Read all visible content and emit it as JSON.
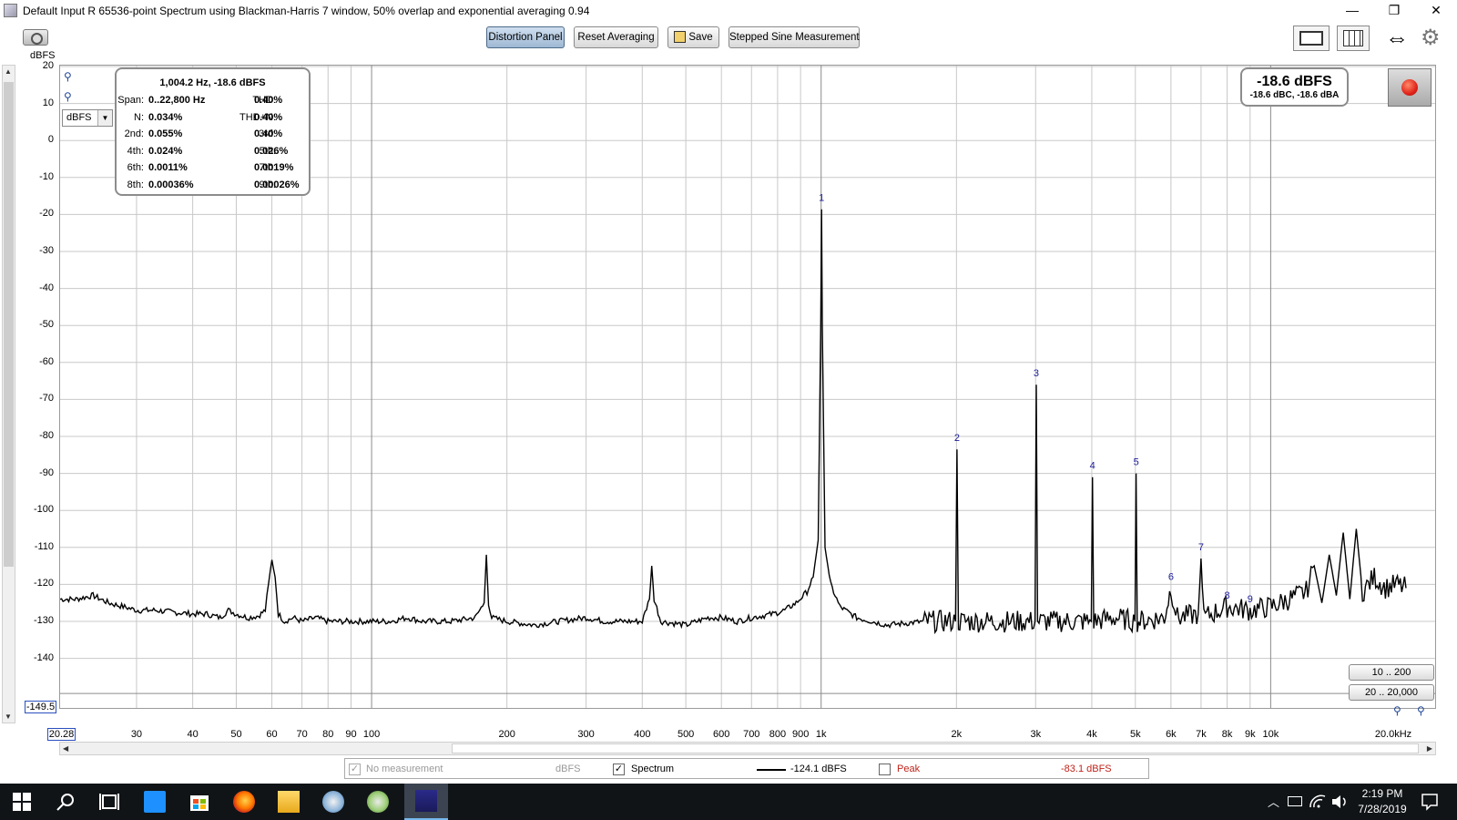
{
  "window": {
    "title": "Default Input R 65536-point Spectrum using Blackman-Harris 7 window, 50% overlap and exponential averaging 0.94",
    "controls": [
      "—",
      "❐",
      "✕"
    ]
  },
  "toolbar": {
    "distortion_panel": "Distortion Panel",
    "reset_averaging": "Reset Averaging",
    "save": "Save",
    "stepped_sine": "Stepped Sine Measurement"
  },
  "axis": {
    "y_unit": "dBFS",
    "y_ticks": [
      "20",
      "10",
      "0",
      "-10",
      "-20",
      "-30",
      "-40",
      "-50",
      "-60",
      "-70",
      "-80",
      "-90",
      "-100",
      "-110",
      "-120",
      "-130",
      "-140"
    ],
    "y_min_box": "-149.5",
    "x_min_box": "20.28",
    "x_ticks": [
      {
        "label": "30",
        "f": 30
      },
      {
        "label": "40",
        "f": 40
      },
      {
        "label": "50",
        "f": 50
      },
      {
        "label": "60",
        "f": 60
      },
      {
        "label": "70",
        "f": 70
      },
      {
        "label": "80",
        "f": 80
      },
      {
        "label": "90",
        "f": 90
      },
      {
        "label": "100",
        "f": 100
      },
      {
        "label": "200",
        "f": 200
      },
      {
        "label": "300",
        "f": 300
      },
      {
        "label": "400",
        "f": 400
      },
      {
        "label": "500",
        "f": 500
      },
      {
        "label": "600",
        "f": 600
      },
      {
        "label": "700",
        "f": 700
      },
      {
        "label": "800",
        "f": 800
      },
      {
        "label": "900",
        "f": 900
      },
      {
        "label": "1k",
        "f": 1000
      },
      {
        "label": "2k",
        "f": 2000
      },
      {
        "label": "3k",
        "f": 3000
      },
      {
        "label": "4k",
        "f": 4000
      },
      {
        "label": "5k",
        "f": 5000
      },
      {
        "label": "6k",
        "f": 6000
      },
      {
        "label": "7k",
        "f": 7000
      },
      {
        "label": "8k",
        "f": 8000
      },
      {
        "label": "9k",
        "f": 9000
      },
      {
        "label": "10k",
        "f": 10000
      },
      {
        "label": "20.0kHz",
        "f": 20000
      }
    ]
  },
  "unit_select": "dBFS",
  "distortion": {
    "header": "1,004.2 Hz, -18.6 dBFS",
    "rows": [
      {
        "l1": "Span:",
        "v1": "0..22,800 Hz",
        "l2": "THD:",
        "v2": "0.40%"
      },
      {
        "l1": "N:",
        "v1": "0.034%",
        "l2": "THD+N:",
        "v2": "0.40%"
      },
      {
        "l1": "2nd:",
        "v1": "0.055%",
        "l2": "3rd:",
        "v2": "0.40%"
      },
      {
        "l1": "4th:",
        "v1": "0.024%",
        "l2": "5th:",
        "v2": "0.026%"
      },
      {
        "l1": "6th:",
        "v1": "0.0011%",
        "l2": "7th:",
        "v2": "0.0019%"
      },
      {
        "l1": "8th:",
        "v1": "0.00036%",
        "l2": "9th:",
        "v2": "0.00026%"
      }
    ]
  },
  "level": {
    "main": "-18.6 dBFS",
    "sub": "-18.6 dBC, -18.6 dBA"
  },
  "range_buttons": [
    "10 .. 200",
    "20 .. 20,000"
  ],
  "legend": {
    "no_measurement": "No measurement",
    "no_measurement_unit": "dBFS",
    "spectrum": "Spectrum",
    "spectrum_value": "-124.1 dBFS",
    "peak": "Peak",
    "peak_value": "-83.1 dBFS",
    "spectrum_checked": true,
    "peak_checked": false
  },
  "taskbar": {
    "time": "2:19 PM",
    "date": "7/28/2019"
  },
  "colors": {
    "trace": "#000000",
    "grid": "#c8c8c8",
    "marker_label": "#1b1b9a",
    "peak_text": "#c0241a",
    "accent": "#4d6a8a"
  },
  "chart_data": {
    "type": "line",
    "title": "",
    "xlabel": "",
    "ylabel": "dBFS",
    "xscale": "log",
    "xlim": [
      20.28,
      20000
    ],
    "ylim": [
      -149.5,
      20
    ],
    "grid": true,
    "series": [
      {
        "name": "Spectrum",
        "points": [
          [
            20.28,
            -124
          ],
          [
            22,
            -124
          ],
          [
            24,
            -123
          ],
          [
            26,
            -125
          ],
          [
            28,
            -126
          ],
          [
            30,
            -127
          ],
          [
            33,
            -127
          ],
          [
            36,
            -127.5
          ],
          [
            40,
            -128
          ],
          [
            43,
            -128
          ],
          [
            46,
            -129
          ],
          [
            48,
            -127
          ],
          [
            50,
            -128
          ],
          [
            53,
            -129
          ],
          [
            56,
            -128.5
          ],
          [
            58,
            -127
          ],
          [
            59,
            -120
          ],
          [
            60,
            -113
          ],
          [
            61,
            -118
          ],
          [
            62,
            -128
          ],
          [
            64,
            -130
          ],
          [
            67,
            -129
          ],
          [
            70,
            -130
          ],
          [
            75,
            -129
          ],
          [
            80,
            -130
          ],
          [
            90,
            -130
          ],
          [
            100,
            -130
          ],
          [
            110,
            -130
          ],
          [
            120,
            -129
          ],
          [
            130,
            -130
          ],
          [
            150,
            -130
          ],
          [
            170,
            -129
          ],
          [
            178,
            -125
          ],
          [
            180,
            -112
          ],
          [
            182,
            -125
          ],
          [
            185,
            -129
          ],
          [
            200,
            -130
          ],
          [
            230,
            -131
          ],
          [
            260,
            -130
          ],
          [
            300,
            -129
          ],
          [
            330,
            -130
          ],
          [
            360,
            -130
          ],
          [
            400,
            -130
          ],
          [
            415,
            -124
          ],
          [
            420,
            -115
          ],
          [
            425,
            -124
          ],
          [
            440,
            -130
          ],
          [
            500,
            -131
          ],
          [
            560,
            -129
          ],
          [
            600,
            -129
          ],
          [
            650,
            -130
          ],
          [
            700,
            -129
          ],
          [
            780,
            -128
          ],
          [
            830,
            -127
          ],
          [
            880,
            -125
          ],
          [
            930,
            -122
          ],
          [
            960,
            -118
          ],
          [
            985,
            -108
          ],
          [
            998,
            -50
          ],
          [
            1002,
            -18.6
          ],
          [
            1006,
            -50
          ],
          [
            1020,
            -110
          ],
          [
            1050,
            -120
          ],
          [
            1100,
            -126
          ],
          [
            1200,
            -129
          ],
          [
            1400,
            -131
          ],
          [
            1700,
            -130
          ],
          [
            1990,
            -130
          ],
          [
            2005,
            -83.5
          ],
          [
            2020,
            -130
          ],
          [
            2500,
            -130
          ],
          [
            2990,
            -130
          ],
          [
            3010,
            -66
          ],
          [
            3030,
            -130
          ],
          [
            3500,
            -130
          ],
          [
            3990,
            -130
          ],
          [
            4015,
            -91
          ],
          [
            4040,
            -130
          ],
          [
            4500,
            -129
          ],
          [
            4990,
            -130
          ],
          [
            5020,
            -90
          ],
          [
            5050,
            -130
          ],
          [
            5800,
            -129
          ],
          [
            6000,
            -121
          ],
          [
            6200,
            -129
          ],
          [
            6900,
            -128
          ],
          [
            7000,
            -113
          ],
          [
            7100,
            -129
          ],
          [
            8000,
            -126
          ],
          [
            9000,
            -127
          ],
          [
            10000,
            -126
          ],
          [
            11000,
            -124
          ],
          [
            12000,
            -122
          ],
          [
            12500,
            -115
          ],
          [
            13000,
            -125
          ],
          [
            13500,
            -112
          ],
          [
            14000,
            -123
          ],
          [
            14500,
            -106
          ],
          [
            15000,
            -124
          ],
          [
            15500,
            -105
          ],
          [
            16000,
            -122
          ],
          [
            17000,
            -118
          ],
          [
            18000,
            -121
          ],
          [
            19000,
            -120
          ],
          [
            20000,
            -121
          ]
        ]
      }
    ],
    "markers": [
      {
        "label": "1",
        "f": 1002,
        "db": -18.6
      },
      {
        "label": "2",
        "f": 2005,
        "db": -83.5
      },
      {
        "label": "3",
        "f": 3010,
        "db": -66
      },
      {
        "label": "4",
        "f": 4015,
        "db": -91
      },
      {
        "label": "5",
        "f": 5020,
        "db": -90
      },
      {
        "label": "6",
        "f": 6000,
        "db": -121
      },
      {
        "label": "7",
        "f": 7000,
        "db": -113
      },
      {
        "label": "8",
        "f": 8000,
        "db": -126
      },
      {
        "label": "9",
        "f": 9000,
        "db": -127
      }
    ]
  }
}
